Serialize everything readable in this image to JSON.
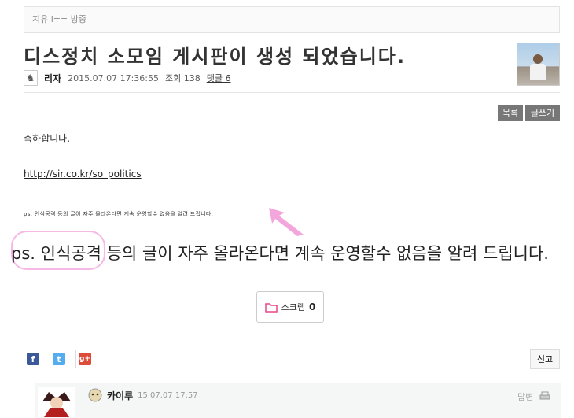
{
  "breadcrumb": "지유 l== 방중",
  "post": {
    "title": "디스정치 소모임 게시판이 생성 되었습니다.",
    "author": "리자",
    "date": "2015.07.07 17:36:55",
    "views": "조회 138",
    "comments_link": "댓글 6"
  },
  "toolbar": {
    "list_label": "목록",
    "write_label": "글쓰기"
  },
  "body": {
    "p1": "축하합니다.",
    "link": "http://sir.co.kr/so_politics",
    "small_note": "ps. 인식공격 등의 글이 자주 올라온다면 계속 운영할수 없음을 알려 드립니다.",
    "zoomed_note": "ps. 인식공격 등의 글이 자주 올라온다면 계속 운영할수 없음을 알려 드립니다."
  },
  "scrap": {
    "label": "스크랩",
    "count": "0"
  },
  "share": {
    "facebook": "f",
    "twitter": "t",
    "googleplus": "g+"
  },
  "report_label": "신고",
  "comment": {
    "author": "카이루",
    "date": "15.07.07 17:57",
    "reply_label": "답변"
  },
  "colors": {
    "accent_pink": "#f3a6dc",
    "button_dark": "#777777",
    "facebook": "#3b5998",
    "twitter": "#55acee",
    "googleplus": "#dd4b39"
  }
}
